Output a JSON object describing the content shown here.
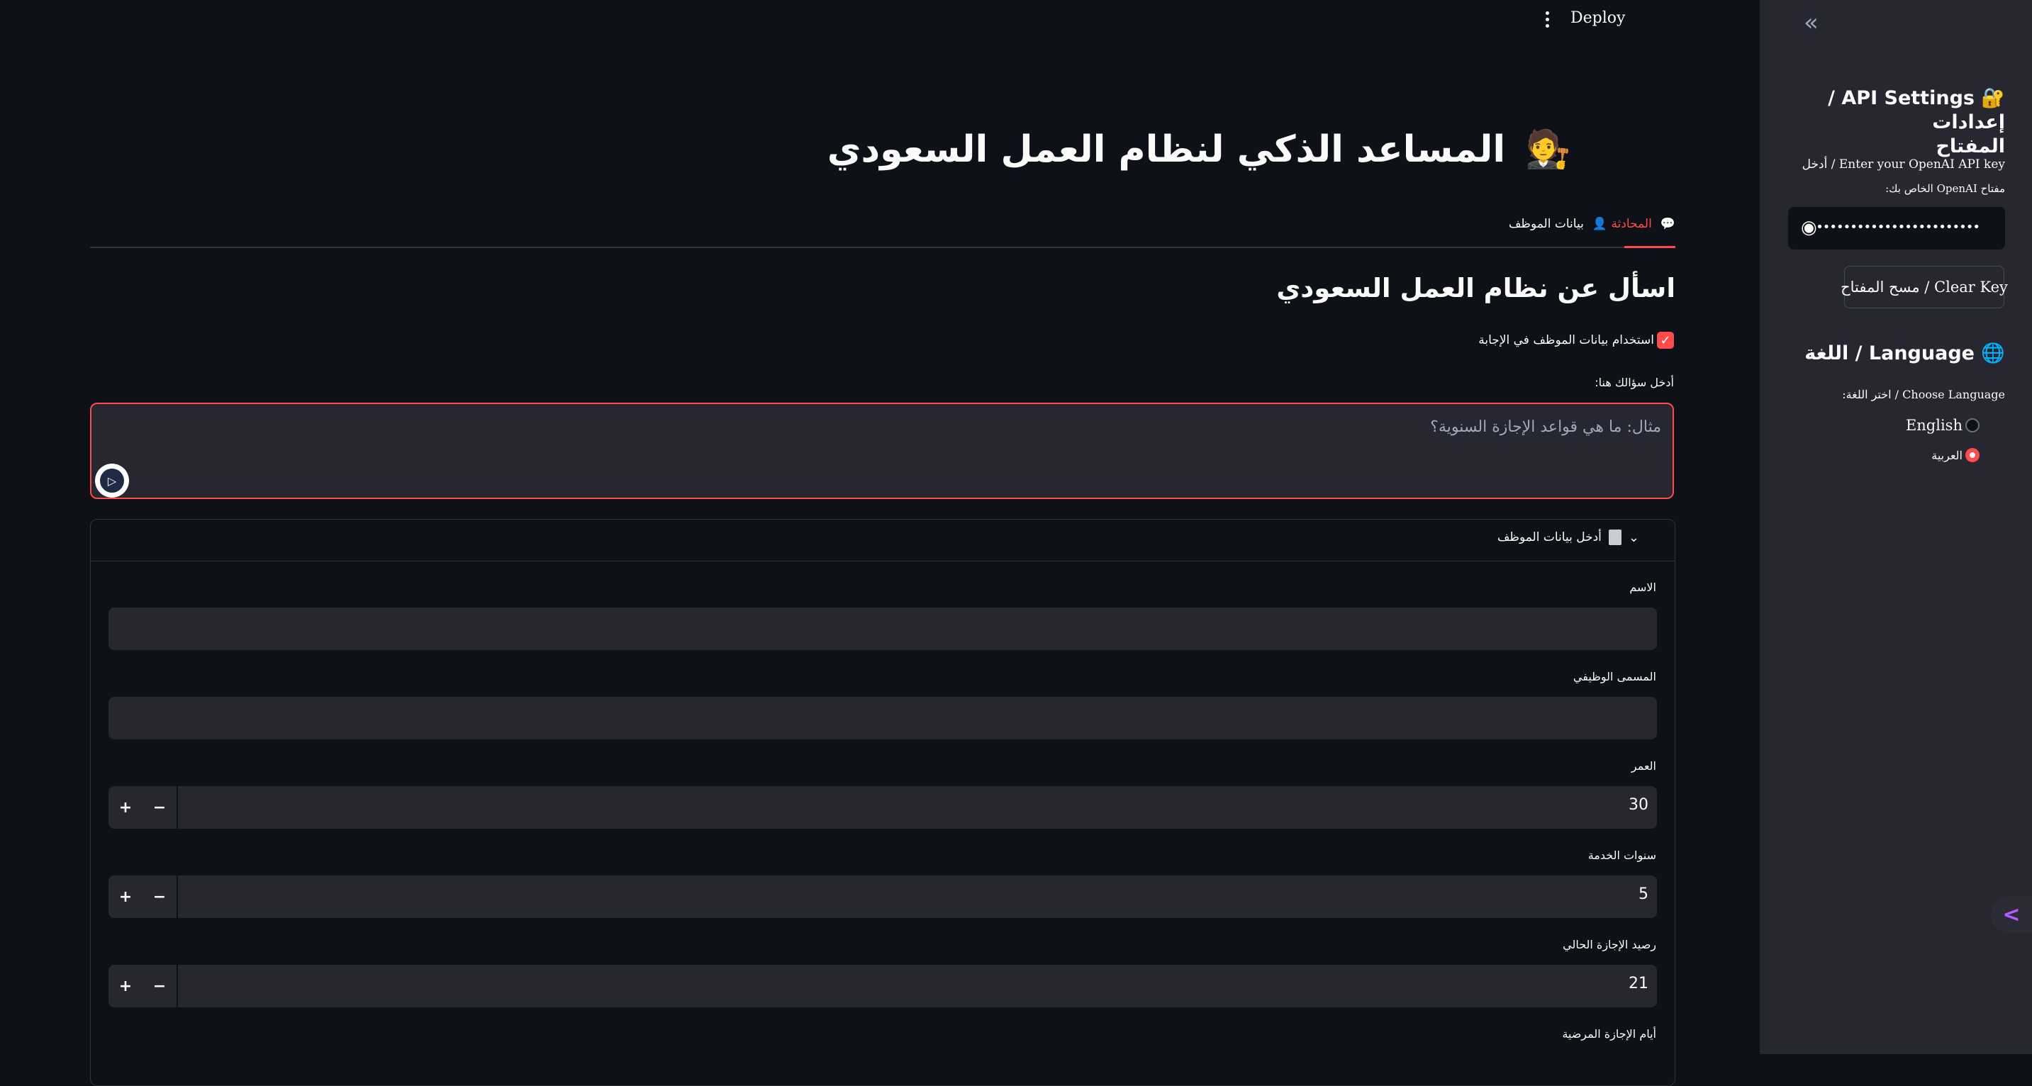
{
  "header": {
    "deploy_label": "Deploy",
    "menu_icon": "vertical-dots-icon"
  },
  "main": {
    "title": "المساعد الذكي لنظام العمل السعودي",
    "title_icon": "🧑‍⚖️",
    "tabs": [
      {
        "label": "المحادثة",
        "icon": "💬",
        "active": true
      },
      {
        "label": "بيانات الموظف",
        "icon": "👤",
        "active": false
      }
    ],
    "section_title": "اسأل عن نظام العمل السعودي",
    "use_employee_checkbox_label": "استخدام بيانات الموظف في الإجابة",
    "use_employee_checked": true,
    "question_label": "أدخل سؤالك هنا:",
    "question_placeholder": "مثال: ما هي قواعد الإجازة السنوية؟",
    "accent_color": "#ff4b4b",
    "expander": {
      "title": "أدخل بيانات الموظف",
      "fields": [
        {
          "label": "الاسم",
          "value": ""
        },
        {
          "label": "المسمى الوظيفي",
          "value": ""
        },
        {
          "label": "العمر",
          "value": "30"
        },
        {
          "label": "سنوات الخدمة",
          "value": "5"
        },
        {
          "label": "رصيد الإجازة الحالي",
          "value": "21"
        },
        {
          "label": "أيام الإجازة المرضية",
          "value": ""
        }
      ]
    }
  },
  "sidebar": {
    "api_title_line1": "🔐 API Settings / إعدادات",
    "api_title_line2": "المفتاح",
    "api_label_line1": "Enter your OpenAI API key / أدخل",
    "api_label_line2": "مفتاح OpenAI الخاص بك:",
    "api_key_masked": "••••••••••••••••••••••••",
    "clear_key_label": "Clear Key / مسح المفتاح",
    "language_title": "🌐 Language / اللغة",
    "language_label": "Choose Language / اختر اللغة:",
    "language_options": [
      {
        "label": "English",
        "selected": false
      },
      {
        "label": "العربية",
        "selected": true
      }
    ]
  }
}
